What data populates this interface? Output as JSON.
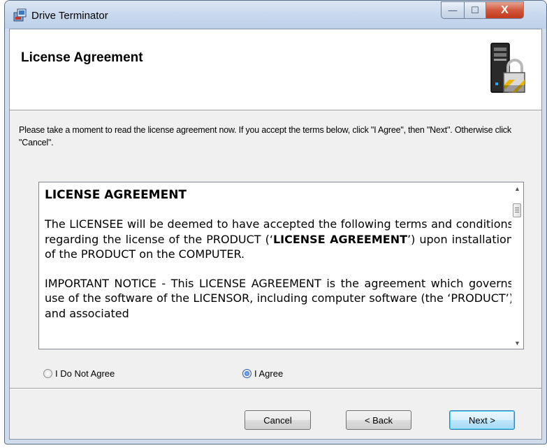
{
  "window": {
    "title": "Drive Terminator",
    "minimize_glyph": "—",
    "maximize_glyph": "☐",
    "close_glyph": "X"
  },
  "header": {
    "title": "License Agreement",
    "icon": "computer-lock-icon"
  },
  "intro": {
    "text": "Please take a moment to read the license agreement now. If you accept the terms below, click \"I Agree\", then \"Next\". Otherwise click \"Cancel\"."
  },
  "license": {
    "heading": "LICENSE AGREEMENT",
    "p1_before": "The LICENSEE will be deemed to have accepted the following terms and conditions regarding the license of the PRODUCT (‘",
    "p1_bold": "LICENSE AGREEMENT",
    "p1_after": "’) upon installation of the PRODUCT on the COMPUTER.",
    "p2": "IMPORTANT NOTICE - This LICENSE AGREEMENT is the agreement which governs use of the software of the LICENSOR, including computer software (the ‘PRODUCT’) and associated"
  },
  "options": {
    "disagree_label": "I Do Not Agree",
    "agree_label": "I Agree",
    "selected": "agree"
  },
  "buttons": {
    "cancel": "Cancel",
    "back": "< Back",
    "next": "Next >"
  }
}
